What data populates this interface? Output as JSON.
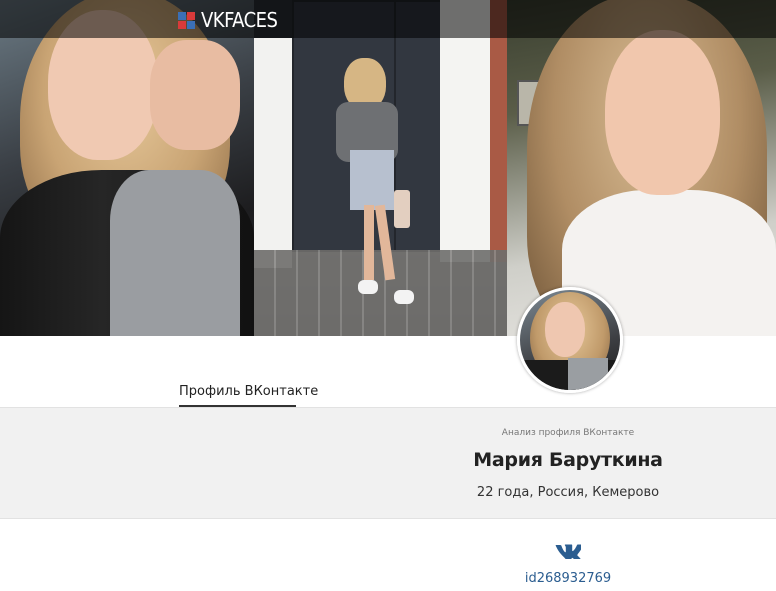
{
  "header": {
    "logo_text": "VKFACES",
    "logo_colors": [
      "#3b6fb6",
      "#d93a3a"
    ]
  },
  "photos": [
    {
      "name": "selfie-leather-jacket"
    },
    {
      "name": "full-length-street-photo"
    },
    {
      "name": "portrait-white-blouse"
    }
  ],
  "tabs": [
    {
      "label": "Профиль ВКонтакте",
      "active": true
    }
  ],
  "profile": {
    "analysis_caption": "Анализ профиля ВКонтакте",
    "name": "Мария Баруткина",
    "meta": "22 года, Россия, Кемерово",
    "vk_icon": "vk-logo-icon",
    "vk_id": "id268932769",
    "link_color": "#2b5d90"
  }
}
